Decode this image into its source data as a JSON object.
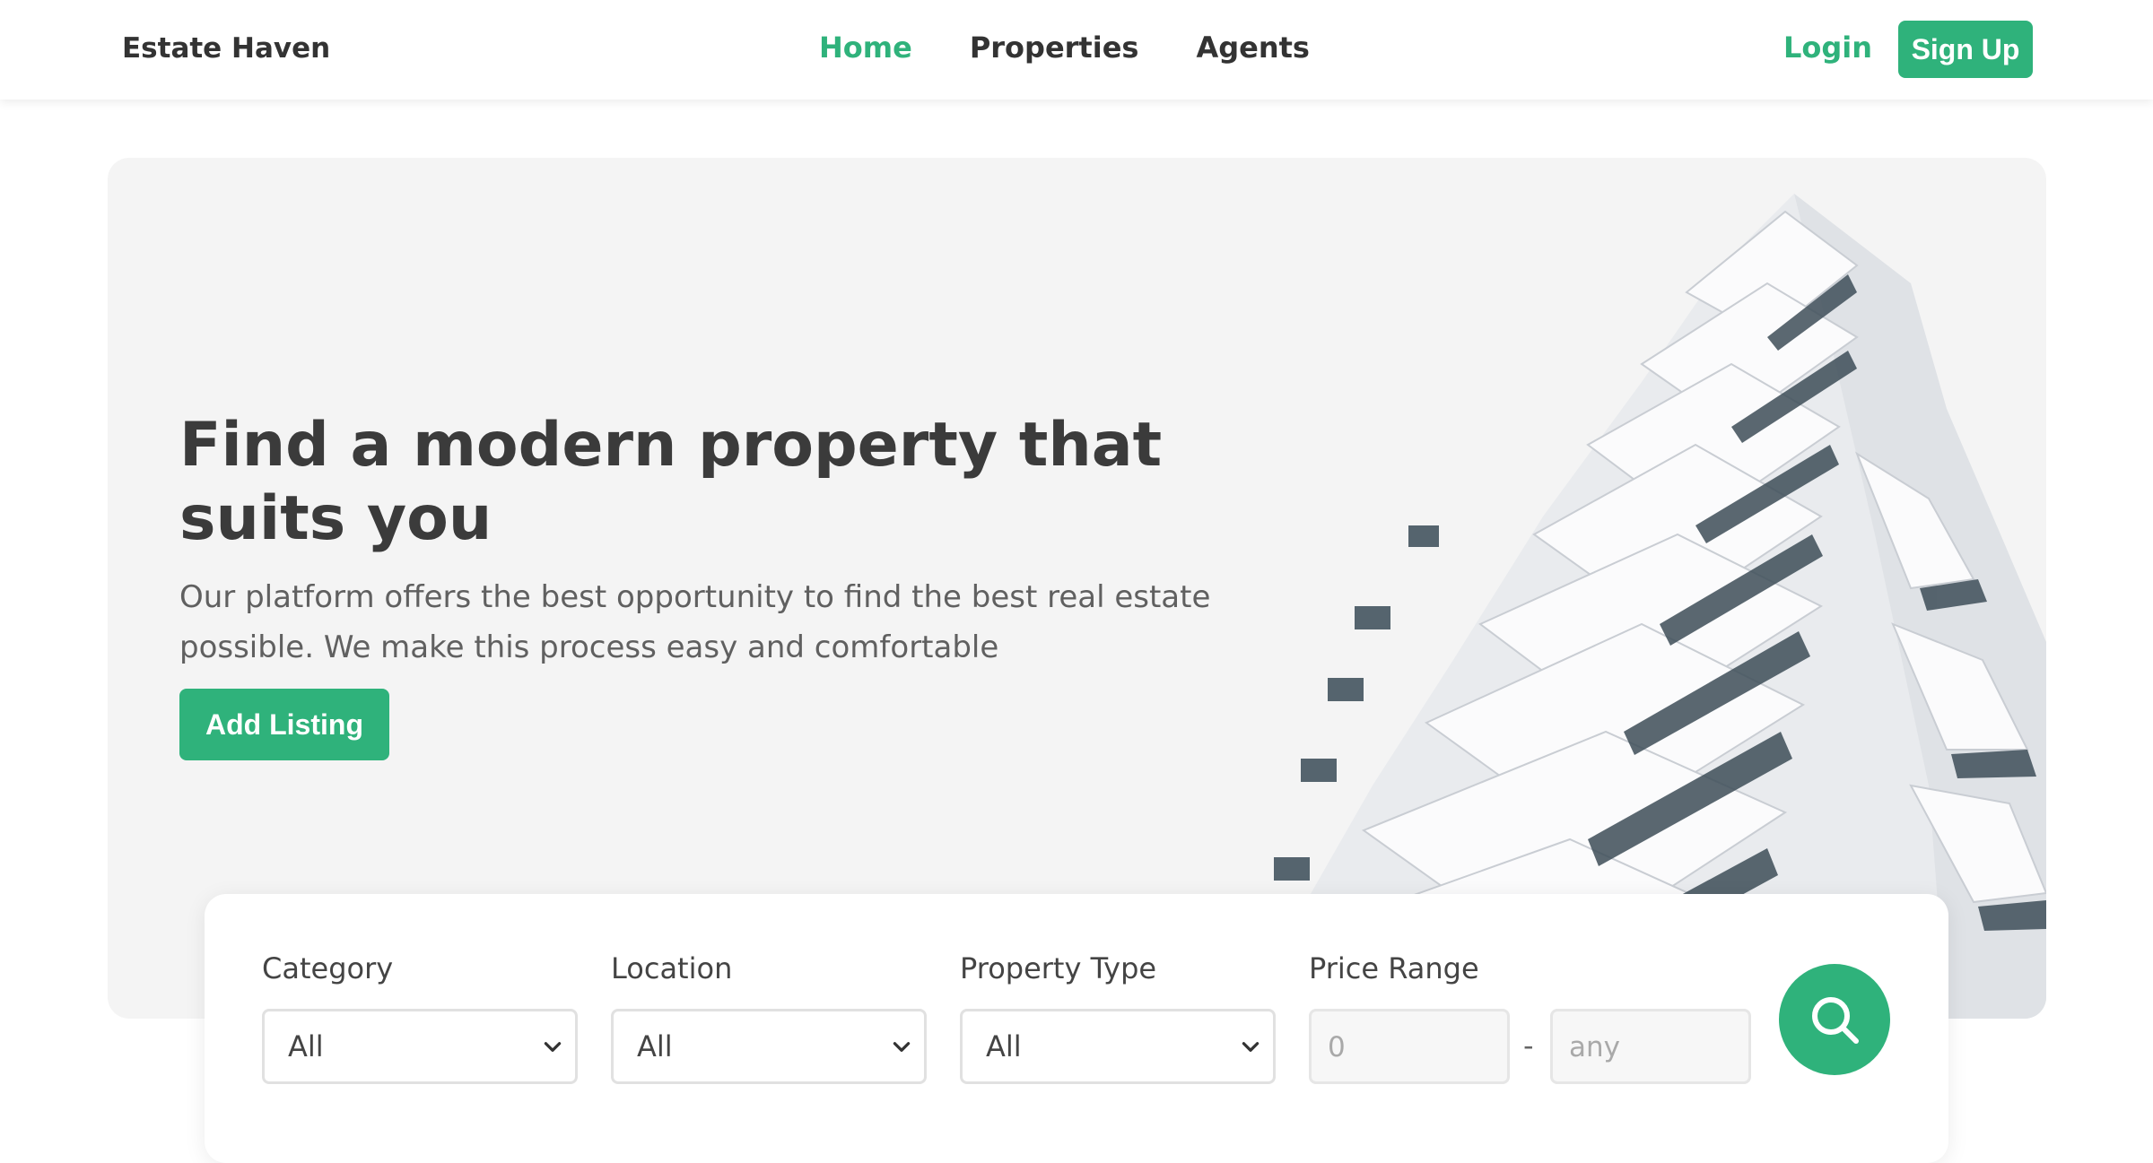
{
  "navbar": {
    "brand": "Estate Haven",
    "links": [
      {
        "label": "Home",
        "active": true
      },
      {
        "label": "Properties",
        "active": false
      },
      {
        "label": "Agents",
        "active": false
      }
    ],
    "login_label": "Login",
    "signup_label": "Sign Up"
  },
  "hero": {
    "title": "Find a modern property that suits you",
    "description": "Our platform offers the best opportunity to find the best real estate possible. We make this process easy and comfortable",
    "add_listing_label": "Add Listing",
    "image": "modern-white-building-photo"
  },
  "search": {
    "category": {
      "label": "Category",
      "value": "All"
    },
    "location": {
      "label": "Location",
      "value": "All"
    },
    "property_type": {
      "label": "Property Type",
      "value": "All"
    },
    "price_range": {
      "label": "Price Range",
      "min_placeholder": "0",
      "max_placeholder": "any",
      "separator": "-"
    },
    "button_icon": "search-icon"
  },
  "colors": {
    "accent": "#2fb27b",
    "hero_bg": "#f4f4f4",
    "text_dark": "#3b3b3b",
    "text_muted": "#606060"
  }
}
